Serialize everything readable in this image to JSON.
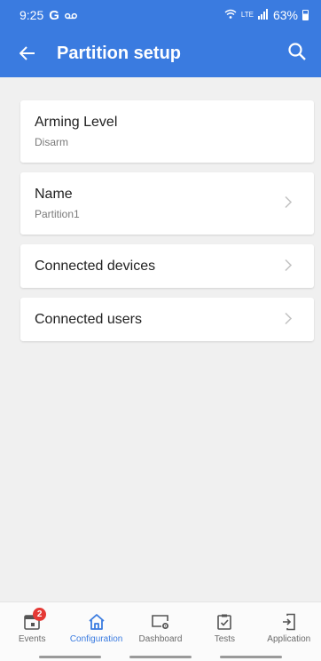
{
  "status_bar": {
    "time": "9:25",
    "google_icon": "G",
    "voicemail_icon": "voicemail-icon",
    "network": "LTE",
    "battery": "63%"
  },
  "app_bar": {
    "title": "Partition setup",
    "back_icon": "arrow-left-icon",
    "search_icon": "search-icon",
    "color": "#3a7be0"
  },
  "settings": [
    {
      "label": "Arming Level",
      "sub": "Disarm",
      "chevron": false
    },
    {
      "label": "Name",
      "sub": "Partition1",
      "chevron": true
    },
    {
      "label": "Connected devices",
      "chevron": true
    },
    {
      "label": "Connected users",
      "chevron": true
    }
  ],
  "bottom_nav": {
    "items": [
      {
        "label": "Events",
        "icon": "calendar-icon",
        "badge": "2"
      },
      {
        "label": "Configuration",
        "icon": "home-icon",
        "active": true
      },
      {
        "label": "Dashboard",
        "icon": "monitor-gear-icon"
      },
      {
        "label": "Tests",
        "icon": "clipboard-check-icon"
      },
      {
        "label": "Application",
        "icon": "phone-login-icon"
      }
    ],
    "active_color": "#3a7be0",
    "badge_color": "#e53935"
  }
}
